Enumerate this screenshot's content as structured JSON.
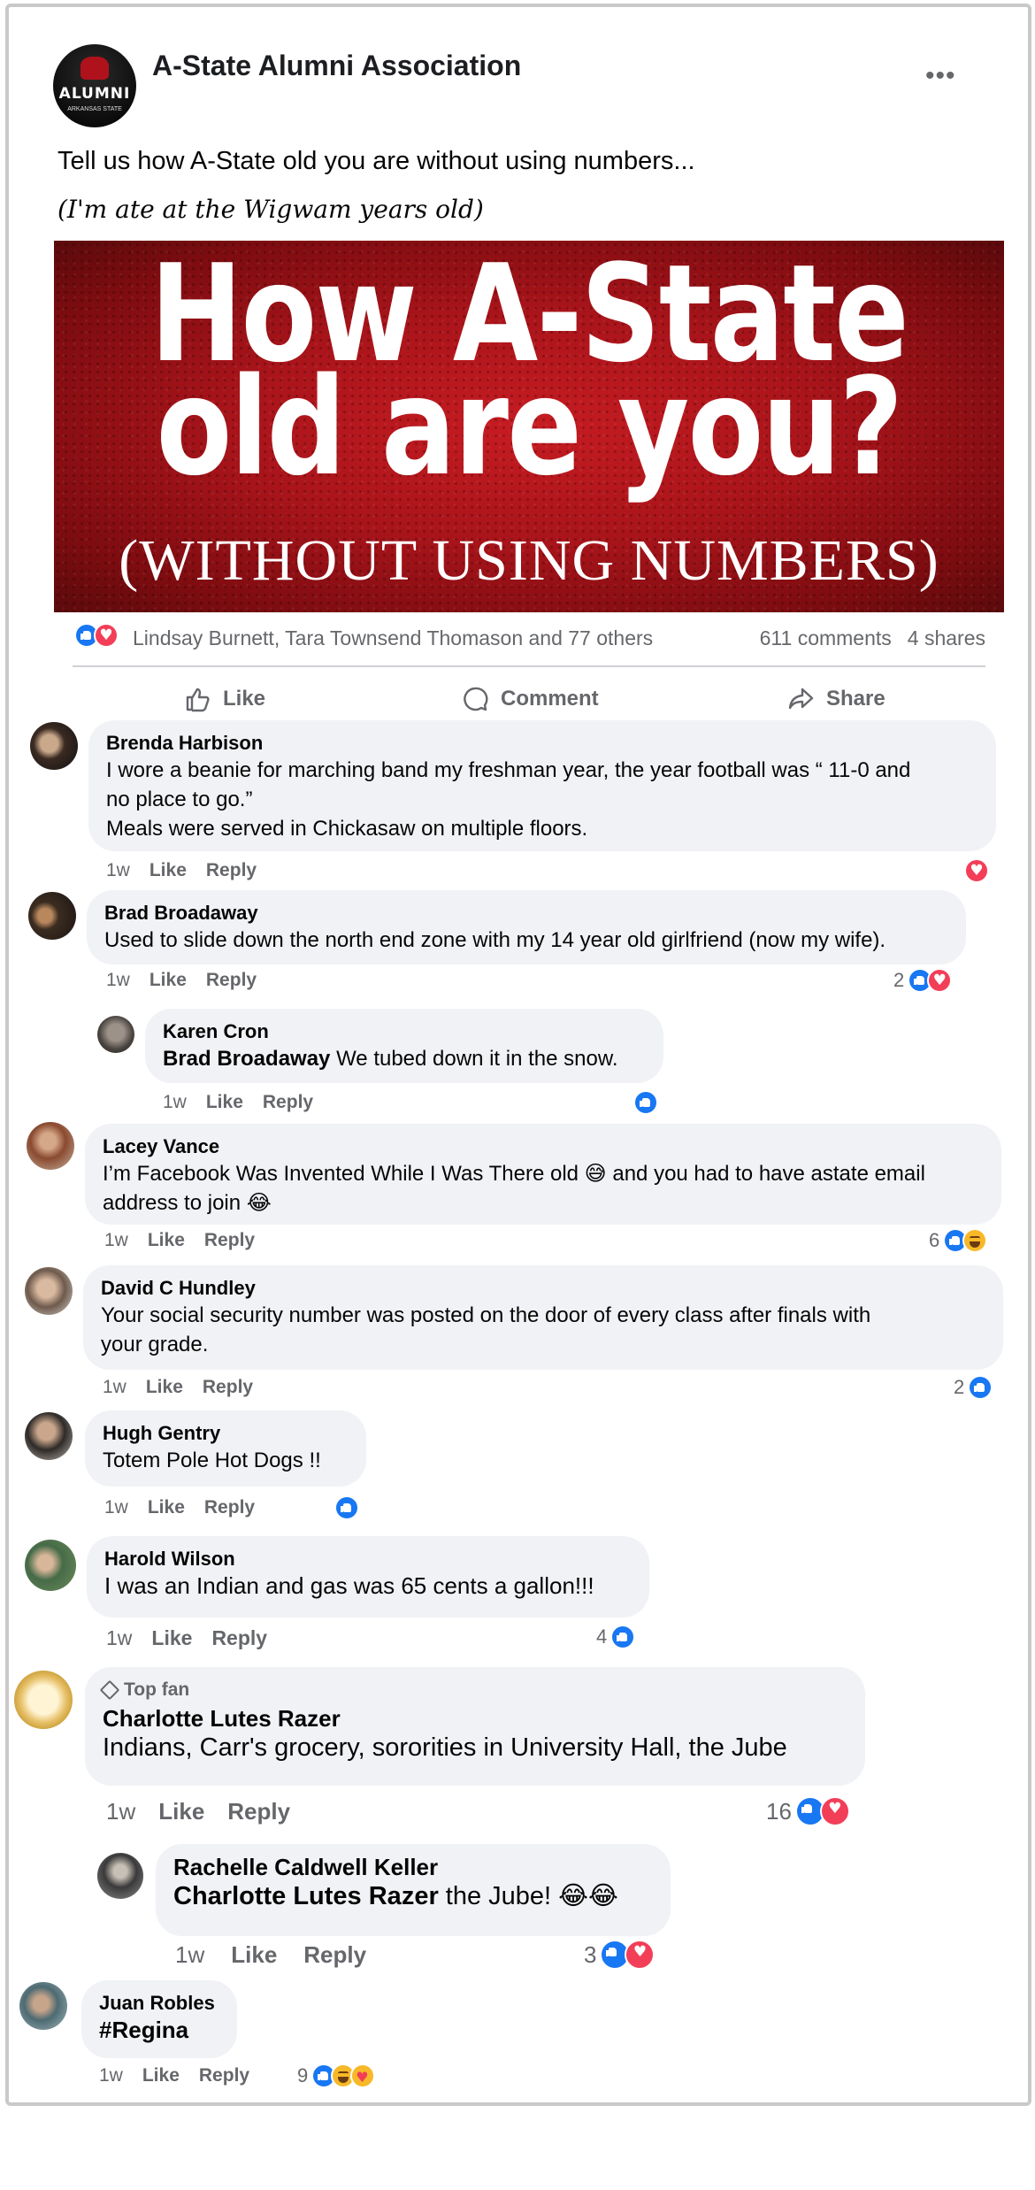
{
  "post": {
    "page_name": "A-State Alumni Association",
    "logo_text": "ALUMNI",
    "logo_subtext": "ARKANSAS STATE",
    "more_label": "•••",
    "text": "Tell us how A-State old you are without using numbers...",
    "subtext": "(I'm ate at the Wigwam years old)",
    "banner": {
      "line1": "How A-State",
      "line2": "old are you?",
      "line3": "(WITHOUT USING NUMBERS)"
    },
    "reactions_names": "Lindsay Burnett, Tara Townsend Thomason and 77 others",
    "comments_count": "611 comments",
    "shares_count": "4 shares",
    "actions": {
      "like": "Like",
      "comment": "Comment",
      "share": "Share"
    }
  },
  "comments": [
    {
      "author": "Brenda Harbison",
      "text1": "I wore a beanie for marching band my freshman year, the year football was “ 11-0 and",
      "text2": "no place to go.”",
      "text3": "Meals were served in Chickasaw on multiple floors.",
      "time": "1w",
      "like": "Like",
      "reply": "Reply",
      "reactions": [
        "love"
      ]
    },
    {
      "author": "Brad Broadaway",
      "text": "Used to slide down the north end zone with my 14 year old girlfriend (now my wife).",
      "time": "1w",
      "like": "Like",
      "reply": "Reply",
      "reaction_count": "2",
      "reactions": [
        "like",
        "love"
      ],
      "replies": [
        {
          "author": "Karen Cron",
          "tag": "Brad Broadaway",
          "text": "We tubed down it in the snow.",
          "time": "1w",
          "like": "Like",
          "reply": "Reply",
          "reactions": [
            "like"
          ]
        }
      ]
    },
    {
      "author": "Lacey Vance",
      "text1": "I’m Facebook Was Invented While I Was There old 😅 and you had to have astate email",
      "text2": "address to join 😂",
      "time": "1w",
      "like": "Like",
      "reply": "Reply",
      "reaction_count": "6",
      "reactions": [
        "like",
        "haha"
      ]
    },
    {
      "author": "David C Hundley",
      "text1": "Your social security number was posted on the door of every class after finals with",
      "text2": "your grade.",
      "time": "1w",
      "like": "Like",
      "reply": "Reply",
      "reaction_count": "2",
      "reactions": [
        "like"
      ]
    },
    {
      "author": "Hugh Gentry",
      "text": "Totem Pole Hot Dogs !!",
      "time": "1w",
      "like": "Like",
      "reply": "Reply",
      "reactions": [
        "like"
      ]
    },
    {
      "author": "Harold Wilson",
      "text": "I was an Indian and gas was 65 cents a gallon!!!",
      "time": "1w",
      "like": "Like",
      "reply": "Reply",
      "reaction_count": "4",
      "reactions": [
        "like"
      ]
    },
    {
      "badge": "Top fan",
      "author": "Charlotte Lutes Razer",
      "text": "Indians, Carr's grocery, sororities in University Hall, the Jube",
      "time": "1w",
      "like": "Like",
      "reply": "Reply",
      "reaction_count": "16",
      "reactions": [
        "like",
        "love"
      ],
      "replies": [
        {
          "author": "Rachelle Caldwell Keller",
          "tag": "Charlotte Lutes Razer",
          "text": "the Jube! 😂😂",
          "time": "1w",
          "like": "Like",
          "reply": "Reply",
          "reaction_count": "3",
          "reactions": [
            "like",
            "love"
          ]
        }
      ]
    },
    {
      "author": "Juan Robles",
      "text": "#Regina",
      "time": "1w",
      "like": "Like",
      "reply": "Reply",
      "reaction_count": "9",
      "reactions": [
        "like",
        "haha",
        "care"
      ]
    }
  ],
  "colors": {
    "like_blue": "#1877f2",
    "love_red": "#f33e58",
    "bubble_gray": "#f0f2f5",
    "meta_gray": "#65676b",
    "banner_red": "#b3141b"
  }
}
